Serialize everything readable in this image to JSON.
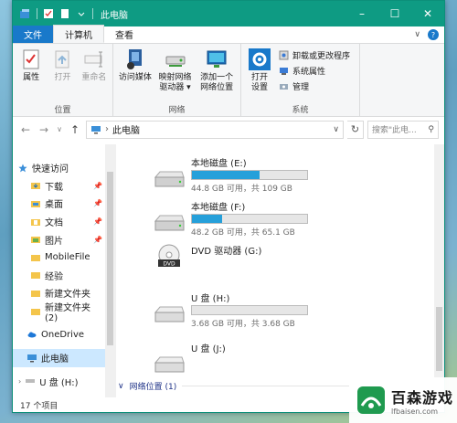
{
  "window": {
    "title": "此电脑",
    "controls": {
      "minimize": "–",
      "maximize": "☐",
      "close": "✕"
    }
  },
  "ribbon_tabs": [
    {
      "label": "文件"
    },
    {
      "label": "计算机"
    },
    {
      "label": "查看"
    }
  ],
  "ribbon_help": "?",
  "ribbon_collapse": "∨",
  "ribbon": {
    "location_group": {
      "label": "位置",
      "buttons": [
        {
          "label": "属性",
          "icon": "checklist-icon"
        },
        {
          "label": "打开",
          "icon": "open-icon"
        },
        {
          "label": "重命名",
          "icon": "rename-icon"
        }
      ]
    },
    "network_group": {
      "label": "网络",
      "buttons": [
        {
          "label": "访问媒体",
          "icon": "media-icon"
        },
        {
          "label": "映射网络驱动器",
          "line1": "映射网络",
          "line2": "驱动器 ▾",
          "icon": "map-drive-icon"
        },
        {
          "label": "添加一个网络位置",
          "line1": "添加一个",
          "line2": "网络位置",
          "icon": "network-location-icon"
        }
      ]
    },
    "system_group": {
      "label": "系统",
      "open_settings": {
        "line1": "打开",
        "line2": "设置"
      },
      "small_buttons": [
        {
          "label": "卸载或更改程序"
        },
        {
          "label": "系统属性"
        },
        {
          "label": "管理"
        }
      ]
    }
  },
  "address": {
    "back": "←",
    "forward": "→",
    "recent": "∨",
    "up": "↑",
    "path": "此电脑",
    "separator": "›",
    "refresh": "↻",
    "search_placeholder": "搜索\"此电...",
    "search_glyph": "⚲"
  },
  "nav": {
    "quick_access": "快速访问",
    "pinned": [
      {
        "label": "下载"
      },
      {
        "label": "桌面"
      },
      {
        "label": "文档"
      },
      {
        "label": "图片"
      }
    ],
    "folders": [
      {
        "label": "MobileFile"
      },
      {
        "label": "经验"
      },
      {
        "label": "新建文件夹"
      },
      {
        "label": "新建文件夹 (2)"
      }
    ],
    "onedrive": "OneDrive",
    "this_pc": "此电脑",
    "usb": "U 盘 (H:)"
  },
  "drives": [
    {
      "name": "本地磁盘 (E:)",
      "detail": "44.8 GB 可用，共 109 GB",
      "used_fraction": 0.59,
      "type": "hdd"
    },
    {
      "name": "本地磁盘 (F:)",
      "detail": "48.2 GB 可用，共 65.1 GB",
      "used_fraction": 0.26,
      "type": "hdd"
    },
    {
      "name": "DVD 驱动器 (G:)",
      "type": "dvd"
    },
    {
      "name": "U 盘 (H:)",
      "detail": "3.68 GB 可用，共 3.68 GB",
      "used_fraction": 0.0,
      "type": "usb"
    },
    {
      "name": "U 盘 (J:)",
      "type": "usb"
    }
  ],
  "network_section": "网络位置 (1)",
  "status": {
    "item_count": "17 个项目"
  },
  "watermark": {
    "title": "百森游戏",
    "url": "lfbaisen.com"
  },
  "colors": {
    "titlebar": "#0e9b83",
    "accent": "#1979ca",
    "fill": "#26a0da",
    "selected": "#cce8ff"
  }
}
